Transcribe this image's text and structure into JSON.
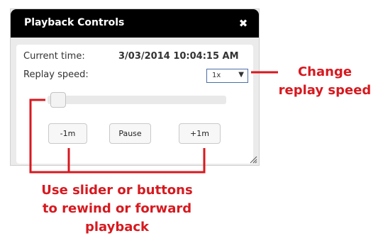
{
  "dialog": {
    "title": "Playback Controls",
    "close_icon": "close-icon",
    "current_time_label": "Current time:",
    "current_time_value": "3/03/2014 10:04:15 AM",
    "replay_speed_label": "Replay speed:",
    "replay_speed_value": "1x",
    "slider_position": 0,
    "buttons": {
      "rewind": "-1m",
      "pause": "Pause",
      "forward": "+1m"
    }
  },
  "annotations": {
    "speed_line1": "Change",
    "speed_line2": "replay speed",
    "slider_line1": "Use slider or buttons",
    "slider_line2": "to rewind or forward",
    "slider_line3": "playback"
  },
  "colors": {
    "titlebar": "#000000",
    "annotation": "#d7191f",
    "panel_background": "#ebebeb"
  }
}
